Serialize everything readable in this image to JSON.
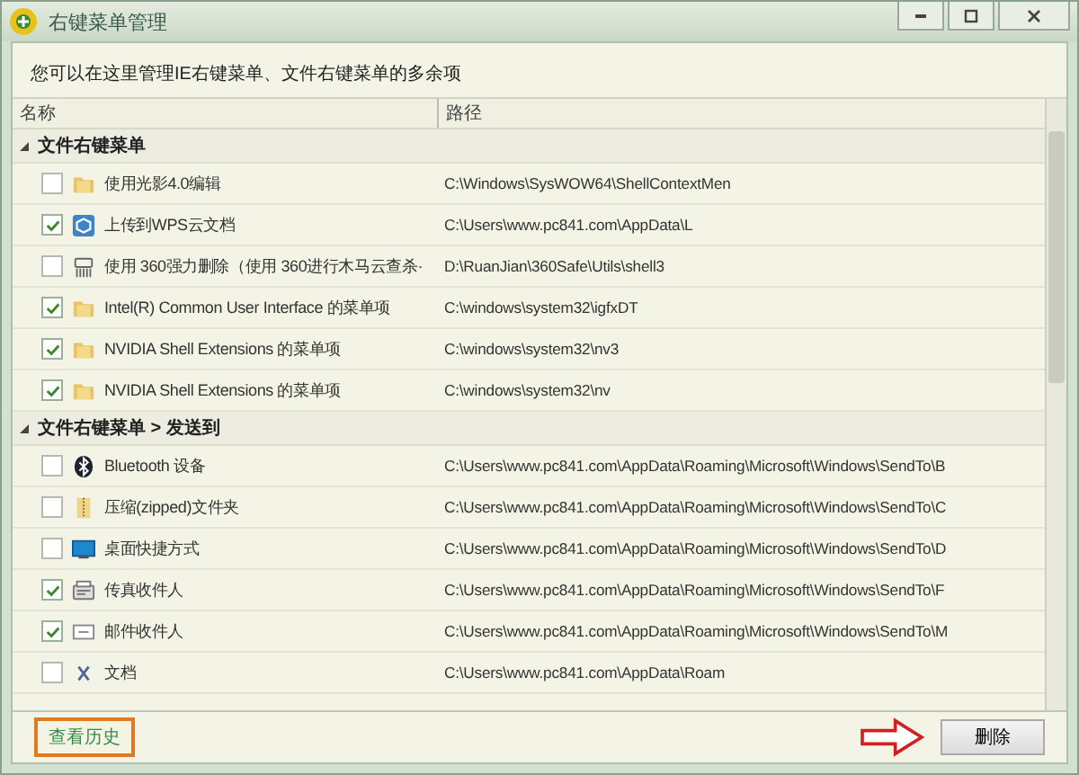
{
  "window": {
    "title": "右键菜单管理"
  },
  "description": "您可以在这里管理IE右键菜单、文件右键菜单的多余项",
  "columns": [
    "名称",
    "路径"
  ],
  "groups": [
    {
      "title": "文件右键菜单",
      "expanded": true,
      "rows": [
        {
          "checked": false,
          "kind": "folder",
          "name": "使用光影4.0编辑",
          "path": "C:\\Windows\\SysWOW64\\ShellContextMen"
        },
        {
          "checked": true,
          "kind": "cube",
          "name": "上传到WPS云文档",
          "path": "C:\\Users\\www.pc841.com\\AppData\\L"
        },
        {
          "checked": false,
          "kind": "shredder",
          "name": "使用 360强力删除（使用 360进行木马云查杀·",
          "path": "D:\\RuanJian\\360Safe\\Utils\\shell3"
        },
        {
          "checked": true,
          "kind": "folder",
          "name": "Intel(R) Common User Interface 的菜单项",
          "path": "C:\\windows\\system32\\igfxDT"
        },
        {
          "checked": true,
          "kind": "folder",
          "name": "NVIDIA Shell Extensions 的菜单项",
          "path": "C:\\windows\\system32\\nv3"
        },
        {
          "checked": true,
          "kind": "folder",
          "name": "NVIDIA Shell Extensions 的菜单项",
          "path": "C:\\windows\\system32\\nv"
        }
      ]
    },
    {
      "title": "文件右键菜单 > 发送到",
      "expanded": true,
      "rows": [
        {
          "checked": false,
          "kind": "bluetooth",
          "name": "Bluetooth 设备",
          "path": "C:\\Users\\www.pc841.com\\AppData\\Roaming\\Microsoft\\Windows\\SendTo\\B"
        },
        {
          "checked": false,
          "kind": "zip",
          "name": "压缩(zipped)文件夹",
          "path": "C:\\Users\\www.pc841.com\\AppData\\Roaming\\Microsoft\\Windows\\SendTo\\C"
        },
        {
          "checked": false,
          "kind": "desktop",
          "name": "桌面快捷方式",
          "path": "C:\\Users\\www.pc841.com\\AppData\\Roaming\\Microsoft\\Windows\\SendTo\\D"
        },
        {
          "checked": true,
          "kind": "fax",
          "name": "传真收件人",
          "path": "C:\\Users\\www.pc841.com\\AppData\\Roaming\\Microsoft\\Windows\\SendTo\\F"
        },
        {
          "checked": true,
          "kind": "mail",
          "name": "邮件收件人",
          "path": "C:\\Users\\www.pc841.com\\AppData\\Roaming\\Microsoft\\Windows\\SendTo\\M"
        },
        {
          "checked": false,
          "kind": "doc",
          "name": "文档",
          "path": "C:\\Users\\www.pc841.com\\AppData\\Roam"
        }
      ]
    }
  ],
  "history_link": "查看历史",
  "delete_button": "删除"
}
